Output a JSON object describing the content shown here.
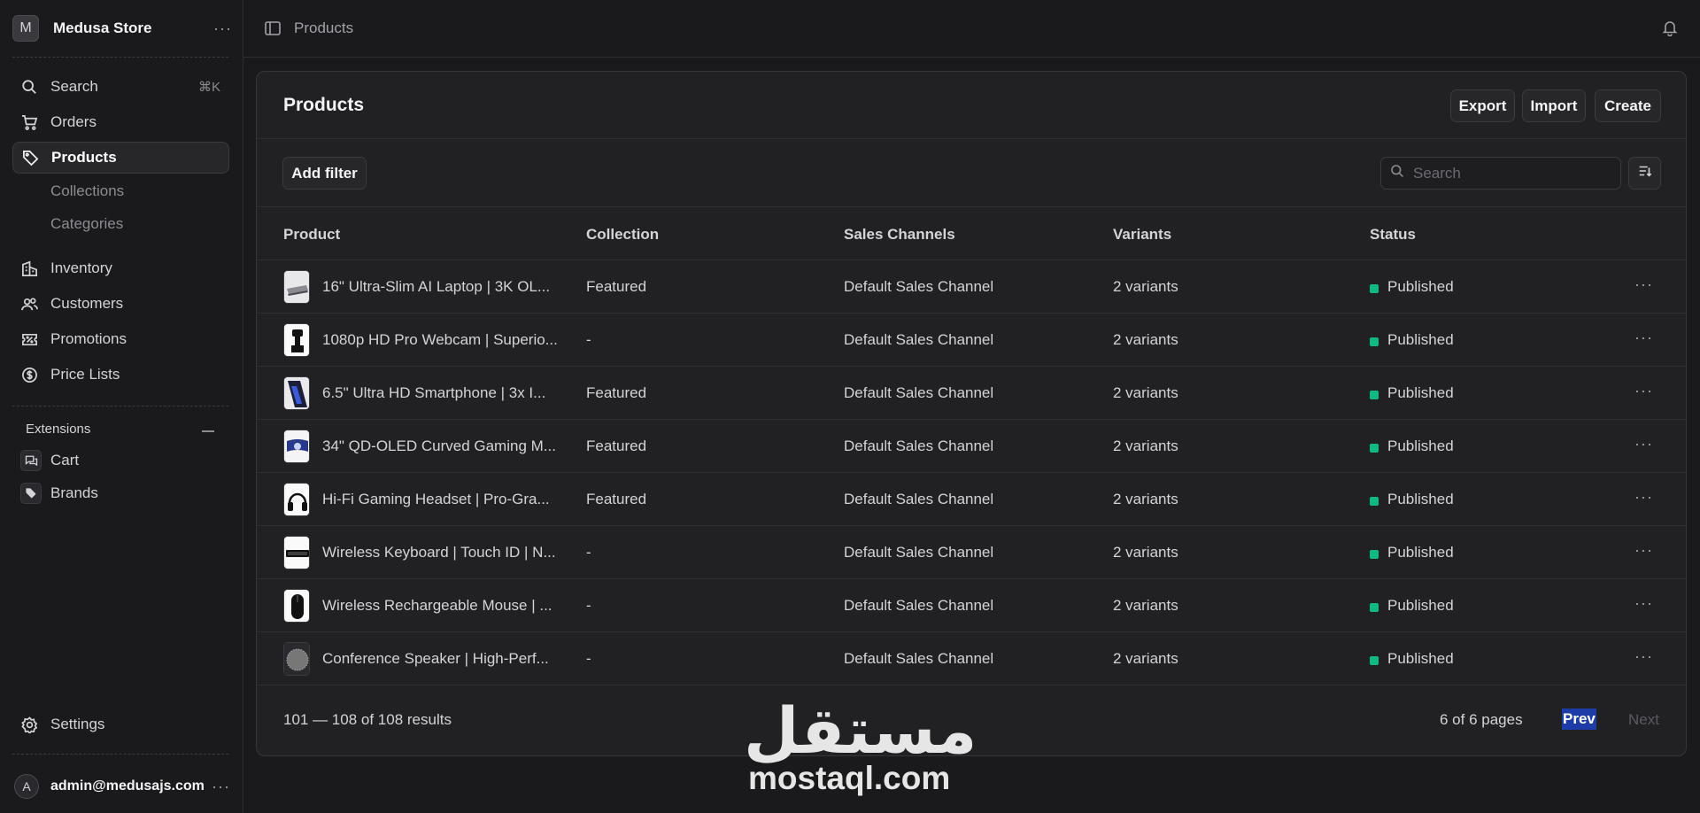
{
  "app": {
    "store_initial": "M",
    "store_name": "Medusa Store",
    "user_initial": "A",
    "user_email": "admin@medusajs.com"
  },
  "sidebar": {
    "search_label": "Search",
    "search_shortcut": "⌘K",
    "items": [
      {
        "label": "Orders",
        "icon": "cart-icon"
      },
      {
        "label": "Products",
        "icon": "tag-icon",
        "active": true
      },
      {
        "label": "Inventory",
        "icon": "building-icon"
      },
      {
        "label": "Customers",
        "icon": "users-icon"
      },
      {
        "label": "Promotions",
        "icon": "receipt-percent-icon"
      },
      {
        "label": "Price Lists",
        "icon": "currency-dollar-icon"
      }
    ],
    "sub_items": [
      "Collections",
      "Categories"
    ],
    "extensions_title": "Extensions",
    "extensions": [
      {
        "label": "Cart",
        "icon": "chat-bubbles-icon"
      },
      {
        "label": "Brands",
        "icon": "tag-icon"
      }
    ],
    "settings_label": "Settings"
  },
  "topbar": {
    "breadcrumb": "Products"
  },
  "page": {
    "title": "Products",
    "buttons": {
      "export": "Export",
      "import": "Import",
      "create": "Create"
    },
    "add_filter": "Add filter",
    "search_placeholder": "Search"
  },
  "table": {
    "columns": [
      "Product",
      "Collection",
      "Sales Channels",
      "Variants",
      "Status"
    ],
    "rows": [
      {
        "product": "16\" Ultra-Slim AI Laptop | 3K OL...",
        "collection": "Featured",
        "channel": "Default Sales Channel",
        "variants": "2 variants",
        "status": "Published"
      },
      {
        "product": "1080p HD Pro Webcam | Superio...",
        "collection": "-",
        "channel": "Default Sales Channel",
        "variants": "2 variants",
        "status": "Published"
      },
      {
        "product": "6.5\" Ultra HD Smartphone | 3x I...",
        "collection": "Featured",
        "channel": "Default Sales Channel",
        "variants": "2 variants",
        "status": "Published"
      },
      {
        "product": "34\" QD-OLED Curved Gaming M...",
        "collection": "Featured",
        "channel": "Default Sales Channel",
        "variants": "2 variants",
        "status": "Published"
      },
      {
        "product": "Hi-Fi Gaming Headset | Pro-Gra...",
        "collection": "Featured",
        "channel": "Default Sales Channel",
        "variants": "2 variants",
        "status": "Published"
      },
      {
        "product": "Wireless Keyboard | Touch ID | N...",
        "collection": "-",
        "channel": "Default Sales Channel",
        "variants": "2 variants",
        "status": "Published"
      },
      {
        "product": "Wireless Rechargeable Mouse | ...",
        "collection": "-",
        "channel": "Default Sales Channel",
        "variants": "2 variants",
        "status": "Published"
      },
      {
        "product": "Conference Speaker | High-Perf...",
        "collection": "-",
        "channel": "Default Sales Channel",
        "variants": "2 variants",
        "status": "Published"
      }
    ],
    "status_color": "#10b981"
  },
  "pagination": {
    "results": "101 — 108 of 108 results",
    "pages": "6 of 6 pages",
    "prev": "Prev",
    "next": "Next"
  },
  "watermark": {
    "arabic": "مستقل",
    "latin": "mostaql.com"
  }
}
